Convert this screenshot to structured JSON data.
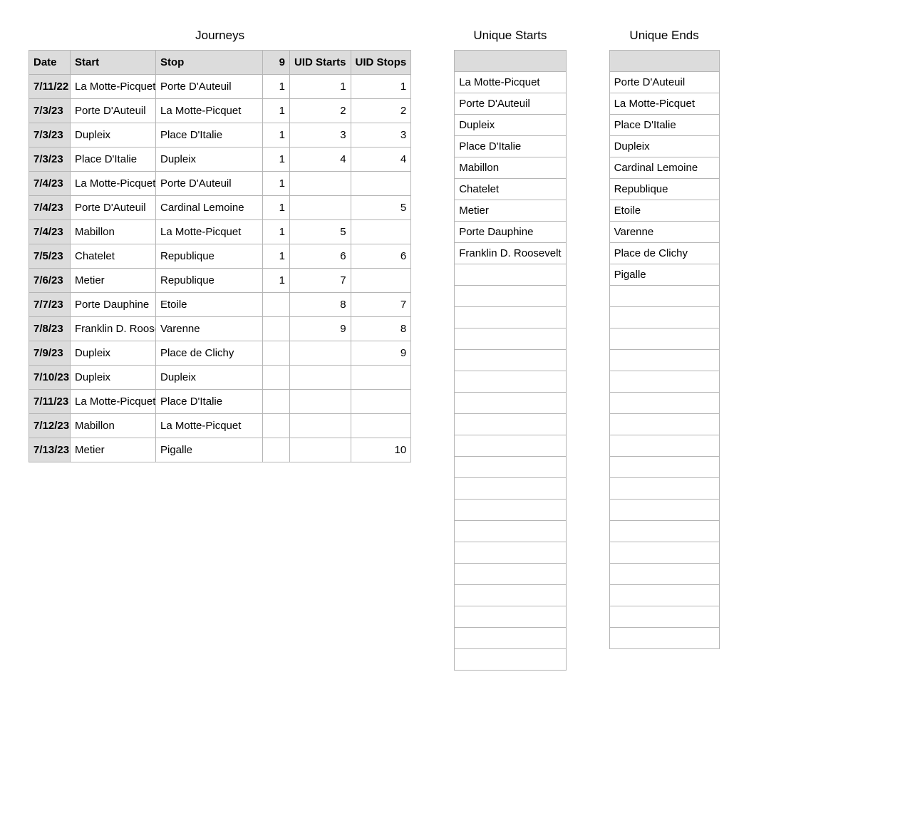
{
  "journeys": {
    "title": "Journeys",
    "headers": {
      "date": "Date",
      "start": "Start",
      "stop": "Stop",
      "count": "9",
      "uid_starts": "UID Starts",
      "uid_stops": "UID Stops"
    },
    "rows": [
      {
        "date": "7/11/22",
        "start": "La Motte-Picquet",
        "stop": "Porte D'Auteuil",
        "n": "1",
        "uid_starts": "1",
        "uid_stops": "1"
      },
      {
        "date": "7/3/23",
        "start": "Porte D'Auteuil",
        "stop": "La Motte-Picquet",
        "n": "1",
        "uid_starts": "2",
        "uid_stops": "2"
      },
      {
        "date": "7/3/23",
        "start": "Dupleix",
        "stop": "Place D'Italie",
        "n": "1",
        "uid_starts": "3",
        "uid_stops": "3"
      },
      {
        "date": "7/3/23",
        "start": "Place D'Italie",
        "stop": "Dupleix",
        "n": "1",
        "uid_starts": "4",
        "uid_stops": "4"
      },
      {
        "date": "7/4/23",
        "start": "La Motte-Picquet",
        "stop": "Porte D'Auteuil",
        "n": "1",
        "uid_starts": "",
        "uid_stops": ""
      },
      {
        "date": "7/4/23",
        "start": "Porte D'Auteuil",
        "stop": "Cardinal Lemoine",
        "n": "1",
        "uid_starts": "",
        "uid_stops": "5"
      },
      {
        "date": "7/4/23",
        "start": "Mabillon",
        "stop": "La Motte-Picquet",
        "n": "1",
        "uid_starts": "5",
        "uid_stops": ""
      },
      {
        "date": "7/5/23",
        "start": "Chatelet",
        "stop": "Republique",
        "n": "1",
        "uid_starts": "6",
        "uid_stops": "6"
      },
      {
        "date": "7/6/23",
        "start": "Metier",
        "stop": "Republique",
        "n": "1",
        "uid_starts": "7",
        "uid_stops": ""
      },
      {
        "date": "7/7/23",
        "start": "Porte Dauphine",
        "stop": "Etoile",
        "n": "",
        "uid_starts": "8",
        "uid_stops": "7"
      },
      {
        "date": "7/8/23",
        "start": "Franklin D. Roose",
        "stop": "Varenne",
        "n": "",
        "uid_starts": "9",
        "uid_stops": "8"
      },
      {
        "date": "7/9/23",
        "start": "Dupleix",
        "stop": "Place de Clichy",
        "n": "",
        "uid_starts": "",
        "uid_stops": "9"
      },
      {
        "date": "7/10/23",
        "start": "Dupleix",
        "stop": "Dupleix",
        "n": "",
        "uid_starts": "",
        "uid_stops": ""
      },
      {
        "date": "7/11/23",
        "start": "La Motte-Picquet",
        "stop": "Place D'Italie",
        "n": "",
        "uid_starts": "",
        "uid_stops": ""
      },
      {
        "date": "7/12/23",
        "start": "Mabillon",
        "stop": "La Motte-Picquet",
        "n": "",
        "uid_starts": "",
        "uid_stops": ""
      },
      {
        "date": "7/13/23",
        "start": "Metier",
        "stop": "Pigalle",
        "n": "",
        "uid_starts": "",
        "uid_stops": "10"
      }
    ]
  },
  "unique_starts": {
    "title": "Unique Starts",
    "items": [
      "La Motte-Picquet",
      "Porte D'Auteuil",
      "Dupleix",
      "Place D'Italie",
      "Mabillon",
      "Chatelet",
      "Metier",
      "Porte Dauphine",
      "Franklin D. Roosevelt"
    ],
    "empty_rows": 19
  },
  "unique_ends": {
    "title": "Unique Ends",
    "items": [
      "Porte D'Auteuil",
      "La Motte-Picquet",
      "Place D'Italie",
      "Dupleix",
      "Cardinal Lemoine",
      "Republique",
      "Etoile",
      "Varenne",
      "Place de Clichy",
      "Pigalle"
    ],
    "empty_rows": 17
  }
}
